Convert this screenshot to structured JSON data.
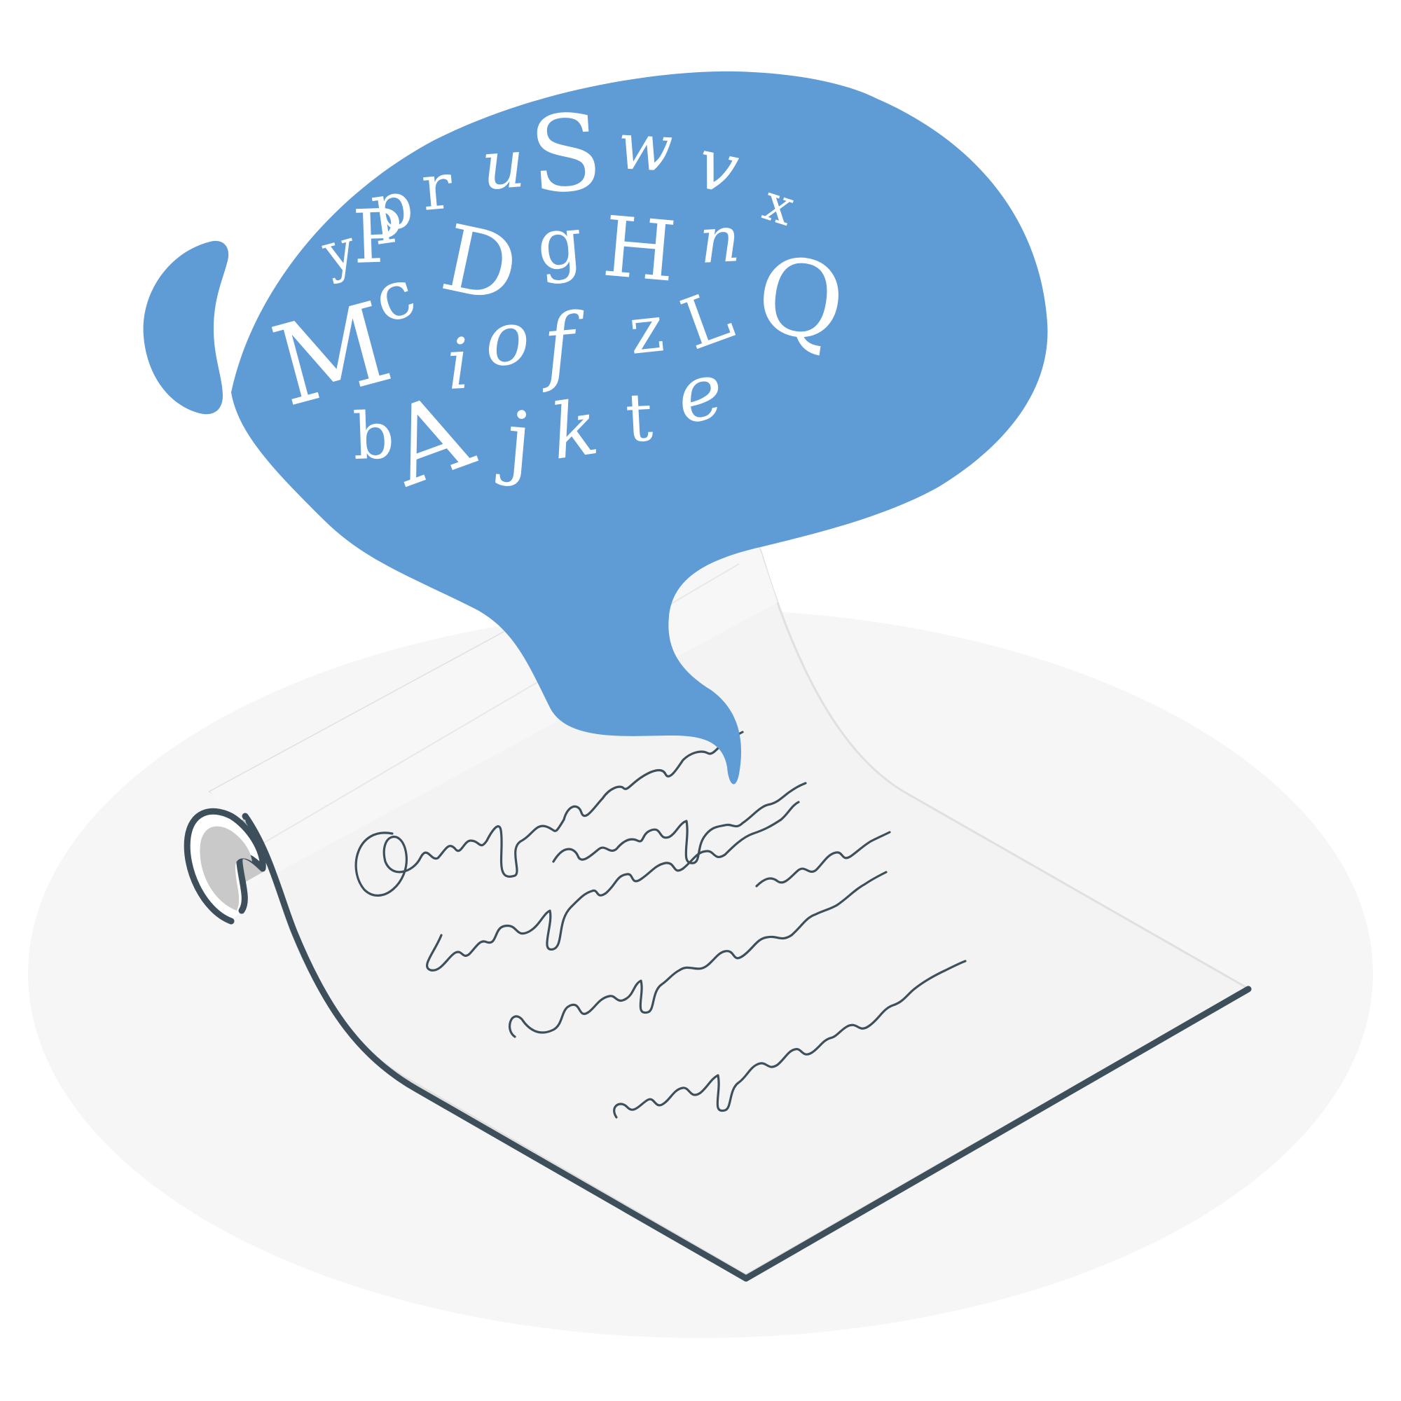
{
  "illustration": {
    "subject": "speech-bubble-of-letters-over-handwritten-scroll",
    "colors": {
      "background": "#ffffff",
      "floor_shadow": "#f6f6f6",
      "bubble": "#5f9bd5",
      "letters": "#ffffff",
      "paper": "#f3f3f3",
      "paper_shade": "#e3e3e3",
      "roll_inside": "#c8c8c8",
      "outline": "#3e4f5c",
      "handwriting": "#3e4f5c"
    }
  },
  "bubble_letters": [
    {
      "id": "y",
      "char": "y"
    },
    {
      "id": "p",
      "char": "p"
    },
    {
      "id": "r",
      "char": "r"
    },
    {
      "id": "u",
      "char": "u"
    },
    {
      "id": "S",
      "char": "S"
    },
    {
      "id": "w",
      "char": "w"
    },
    {
      "id": "v",
      "char": "v"
    },
    {
      "id": "x",
      "char": "x"
    },
    {
      "id": "P2",
      "char": "P"
    },
    {
      "id": "D",
      "char": "D"
    },
    {
      "id": "g",
      "char": "g"
    },
    {
      "id": "H",
      "char": "H"
    },
    {
      "id": "n",
      "char": "n"
    },
    {
      "id": "M",
      "char": "M"
    },
    {
      "id": "c",
      "char": "c"
    },
    {
      "id": "i",
      "char": "i"
    },
    {
      "id": "o",
      "char": "o"
    },
    {
      "id": "f",
      "char": "f"
    },
    {
      "id": "z",
      "char": "z"
    },
    {
      "id": "L",
      "char": "L"
    },
    {
      "id": "Q",
      "char": "Q"
    },
    {
      "id": "b",
      "char": "b"
    },
    {
      "id": "A",
      "char": "A"
    },
    {
      "id": "j",
      "char": "j"
    },
    {
      "id": "k",
      "char": "k"
    },
    {
      "id": "t",
      "char": "t"
    },
    {
      "id": "e",
      "char": "e"
    }
  ],
  "handwriting_lines": 6
}
